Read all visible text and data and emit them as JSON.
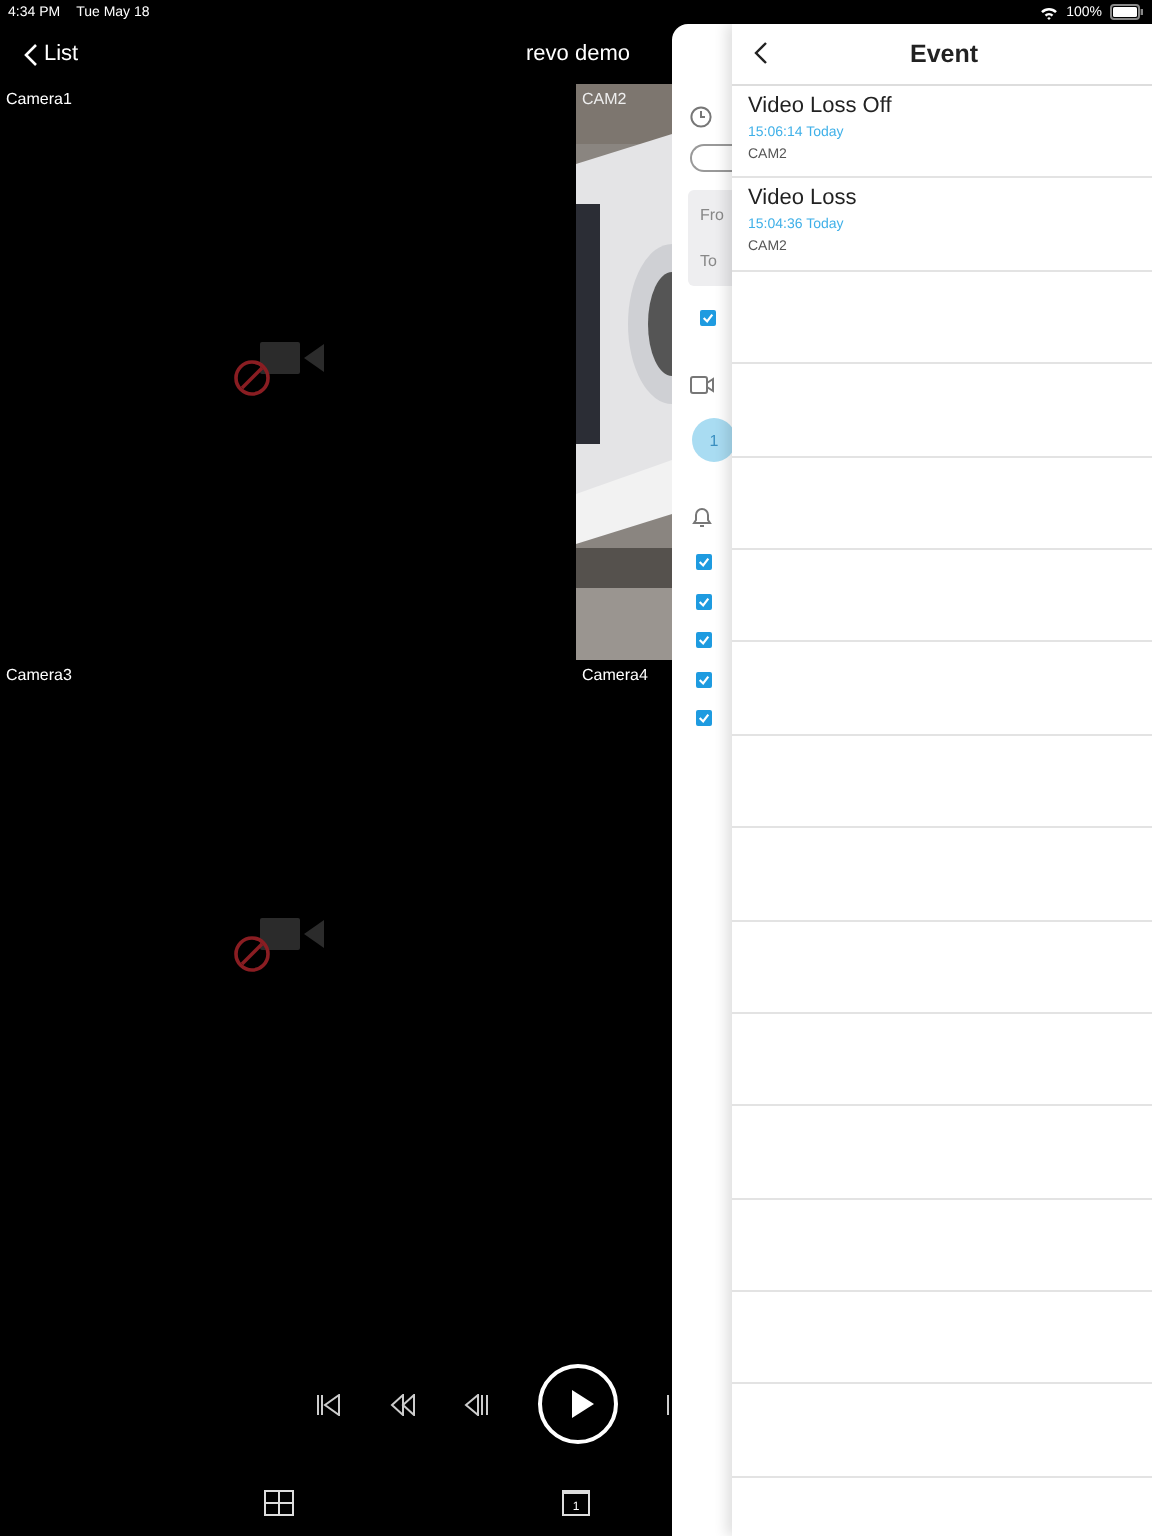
{
  "status_bar": {
    "time": "4:34 PM",
    "date": "Tue May 18",
    "battery": "100%"
  },
  "nav": {
    "back": "List",
    "title": "revo demo"
  },
  "cameras": [
    {
      "label": "Camera1",
      "kind": "no_signal"
    },
    {
      "label": "CAM2",
      "kind": "picture"
    },
    {
      "label": "Camera3",
      "kind": "no_signal"
    },
    {
      "label": "Camera4",
      "kind": "empty"
    }
  ],
  "filter_panel": {
    "from_label": "Fro",
    "to_label": "To",
    "option_checked": true,
    "channel": "1",
    "event_types": [
      {
        "checked": true
      },
      {
        "checked": true
      },
      {
        "checked": true
      },
      {
        "checked": true
      },
      {
        "checked": true
      }
    ]
  },
  "event_panel": {
    "title": "Event",
    "events": [
      {
        "title": "Video Loss Off",
        "time": "15:06:14 Today",
        "camera": "CAM2"
      },
      {
        "title": "Video Loss",
        "time": "15:04:36 Today",
        "camera": "CAM2"
      }
    ]
  },
  "view_buttons": {
    "single_label": "1"
  }
}
